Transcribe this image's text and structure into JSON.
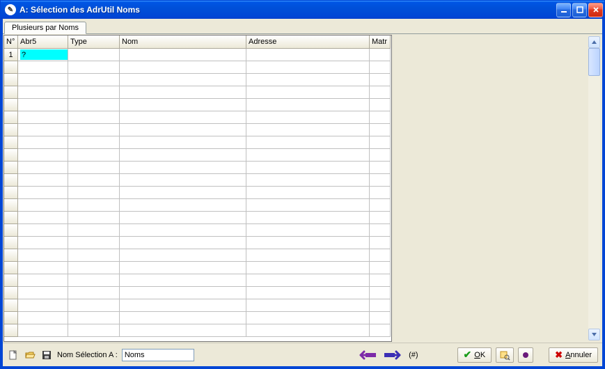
{
  "titlebar": {
    "app_icon_glyph": "✎",
    "title": "A: Sélection des AdrUtil Noms"
  },
  "tabs": [
    {
      "label": "Plusieurs par Noms"
    }
  ],
  "grid": {
    "columns": [
      {
        "key": "num",
        "label": "N°"
      },
      {
        "key": "abr5",
        "label": "Abr5"
      },
      {
        "key": "type",
        "label": "Type"
      },
      {
        "key": "nom",
        "label": "Nom"
      },
      {
        "key": "adresse",
        "label": "Adresse"
      },
      {
        "key": "matr",
        "label": "Matr"
      }
    ],
    "rows": [
      {
        "num": "1",
        "abr5": "?",
        "type": "",
        "nom": "",
        "adresse": "",
        "matr": ""
      }
    ],
    "visible_row_count": 23,
    "ellipsis_btn": "…"
  },
  "bottombar": {
    "label": "Nom Sélection A :",
    "value": "Noms",
    "hash": "(#)",
    "ok_label": "OK",
    "cancel_label": "Annuler"
  },
  "icons": {
    "new": "new-file-icon",
    "open": "open-folder-icon",
    "save": "save-disk-icon",
    "prev": "arrow-left-icon",
    "next": "arrow-right-icon",
    "find": "find-icon",
    "dot": "record-dot-icon"
  }
}
